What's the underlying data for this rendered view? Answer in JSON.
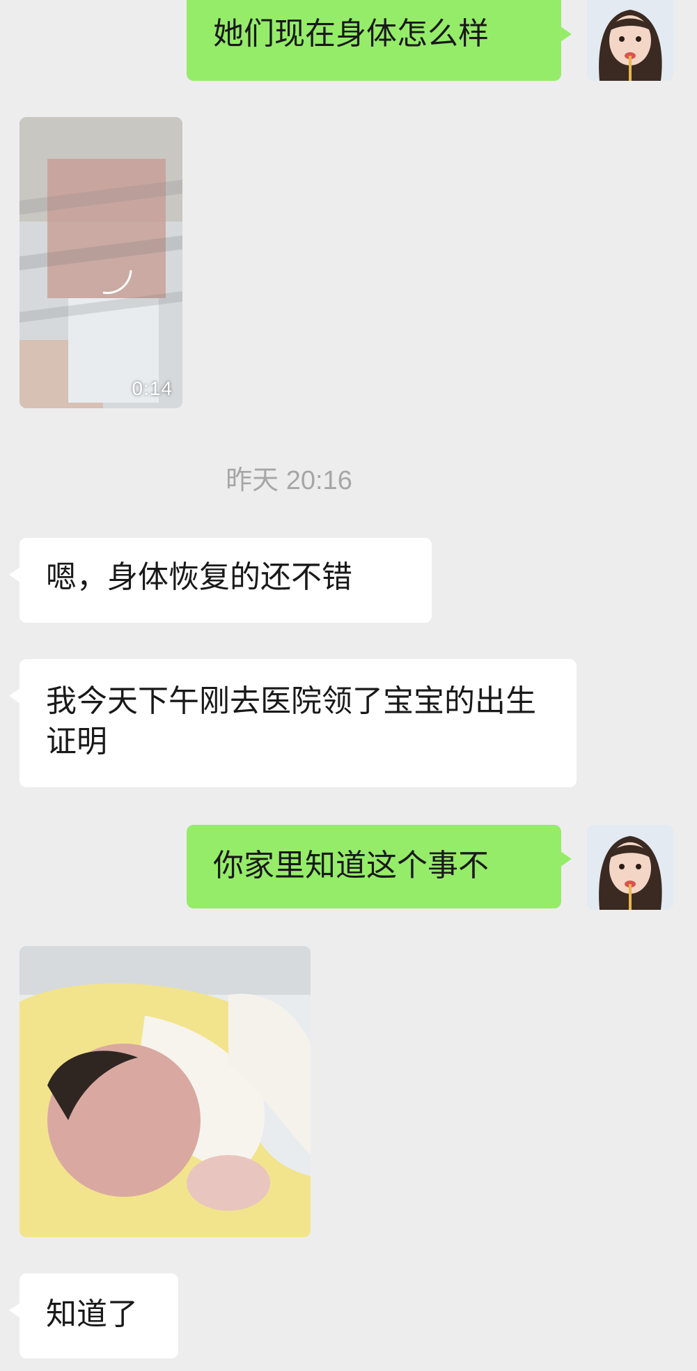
{
  "colors": {
    "background": "#ededed",
    "outgoing_bubble": "#95ec69",
    "incoming_bubble": "#ffffff",
    "timestamp_text": "#a6a6a6"
  },
  "messages": [
    {
      "direction": "out",
      "type": "text",
      "text": "她们现在身体怎么样"
    },
    {
      "direction": "in",
      "type": "video",
      "duration": "0:14",
      "icon": "blurred-video-thumbnail"
    },
    {
      "direction": "system",
      "type": "timestamp",
      "text": "昨天 20:16"
    },
    {
      "direction": "in",
      "type": "text",
      "text": "嗯，身体恢复的还不错"
    },
    {
      "direction": "in",
      "type": "text",
      "text": "我今天下午刚去医院领了宝宝的出生证明"
    },
    {
      "direction": "out",
      "type": "text",
      "text": "你家里知道这个事不"
    },
    {
      "direction": "in",
      "type": "image",
      "icon": "blurred-baby-photo"
    },
    {
      "direction": "in",
      "type": "text",
      "text": "知道了"
    }
  ]
}
